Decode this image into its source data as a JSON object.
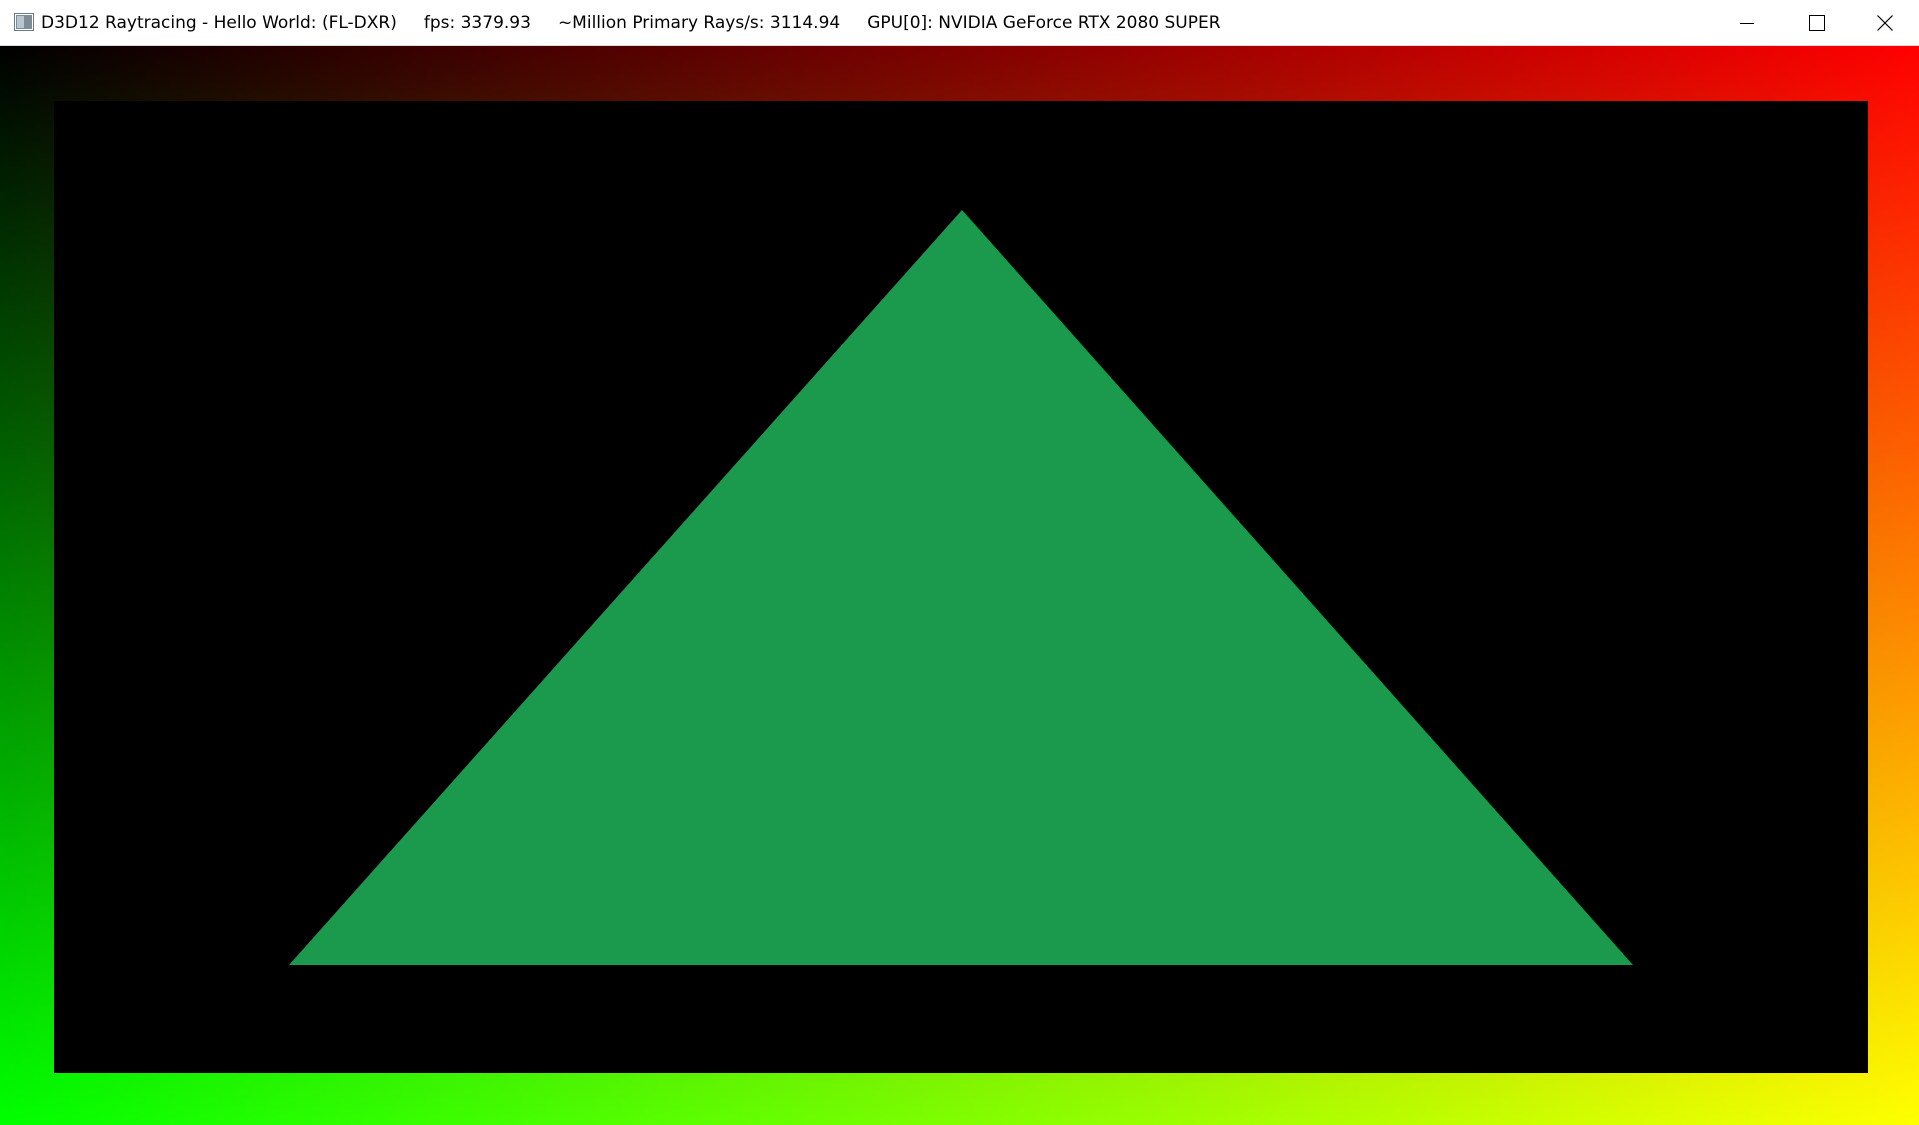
{
  "window": {
    "title": "D3D12 Raytracing - Hello World: (FL-DXR)     fps: 3379.93     ~Million Primary Rays/s: 3114.94     GPU[0]: NVIDIA GeForce RTX 2080 SUPER",
    "controls": {
      "minimize_icon": "minimize-icon",
      "maximize_icon": "maximize-icon",
      "close_icon": "close-icon"
    }
  },
  "render": {
    "background_gradient": {
      "top_left": "#000000",
      "top_right": "#ff0000",
      "bottom_left": "#00ff00",
      "bottom_right": "#ffff00"
    },
    "viewport_color": "#000000",
    "triangle_color": "#1b9a4e"
  }
}
